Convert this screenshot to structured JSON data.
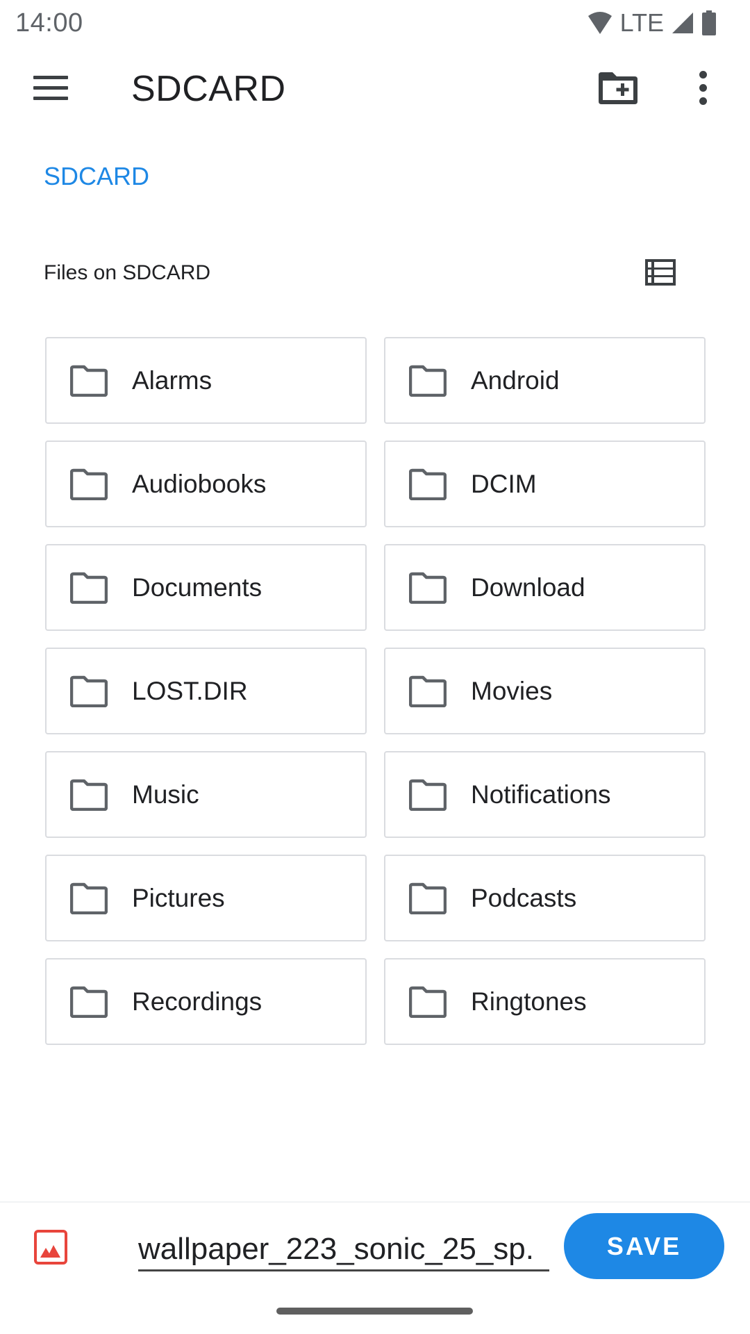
{
  "status_bar": {
    "time": "14:00",
    "network": "LTE",
    "icons": [
      "wifi-icon",
      "signal-icon",
      "battery-icon"
    ]
  },
  "toolbar": {
    "title": "SDCARD",
    "menu_icon": "hamburger-menu-icon",
    "new_folder_icon": "create-new-folder-icon",
    "more_icon": "more-vert-icon"
  },
  "breadcrumb": {
    "items": [
      "SDCARD"
    ]
  },
  "section": {
    "label": "Files on SDCARD",
    "view_toggle_icon": "list-view-icon"
  },
  "folders": [
    {
      "name": "Alarms"
    },
    {
      "name": "Android"
    },
    {
      "name": "Audiobooks"
    },
    {
      "name": "DCIM"
    },
    {
      "name": "Documents"
    },
    {
      "name": "Download"
    },
    {
      "name": "LOST.DIR"
    },
    {
      "name": "Movies"
    },
    {
      "name": "Music"
    },
    {
      "name": "Notifications"
    },
    {
      "name": "Pictures"
    },
    {
      "name": "Podcasts"
    },
    {
      "name": "Recordings"
    },
    {
      "name": "Ringtones"
    }
  ],
  "save_bar": {
    "file_type_icon": "image-file-icon",
    "filename": "wallpaper_223_sonic_25_sp.",
    "save_label": "SAVE"
  },
  "colors": {
    "accent": "#1e88e5",
    "image_icon": "#e8453c",
    "card_border": "#dadce0",
    "icon_gray": "#5f6368"
  }
}
